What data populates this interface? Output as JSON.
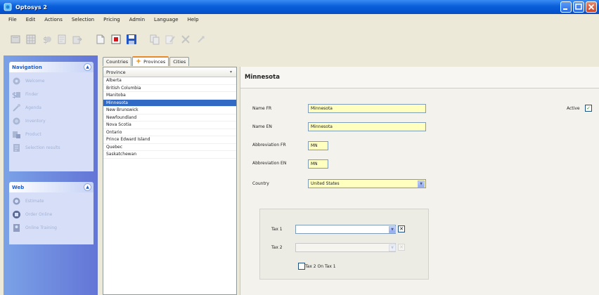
{
  "window": {
    "title": "Optosys 2"
  },
  "menu": [
    "File",
    "Edit",
    "Actions",
    "Selection",
    "Pricing",
    "Admin",
    "Language",
    "Help"
  ],
  "colors": {
    "accent": "#316ac5",
    "required_field": "#ffffc0",
    "title_bar": "#0a5fd8",
    "active_tab": "#e68b2c"
  },
  "sidebar": {
    "navigation": {
      "title": "Navigation",
      "items": [
        {
          "label": "Welcome",
          "icon": "welcome-icon"
        },
        {
          "label": "Finder",
          "icon": "finder-icon"
        },
        {
          "label": "Agenda",
          "icon": "agenda-icon"
        },
        {
          "label": "Inventory",
          "icon": "inventory-icon"
        },
        {
          "label": "Product",
          "icon": "product-icon"
        },
        {
          "label": "Selection results",
          "icon": "selection-icon"
        }
      ]
    },
    "web": {
      "title": "Web",
      "items": [
        {
          "label": "Estimate",
          "icon": "estimate-icon"
        },
        {
          "label": "Order Online",
          "icon": "order-icon"
        },
        {
          "label": "Online Training",
          "icon": "training-icon"
        }
      ]
    }
  },
  "tabs": [
    {
      "label": "Countries",
      "active": false
    },
    {
      "label": "Provinces",
      "active": true
    },
    {
      "label": "Cities",
      "active": false
    }
  ],
  "list": {
    "header": "Province",
    "items": [
      "Alberta",
      "British Columbia",
      "Manitoba",
      "Minnesota",
      "New Brunswick",
      "Newfoundland",
      "Nova Scotia",
      "Ontario",
      "Prince Edward Island",
      "Quebec",
      "Saskatchewan"
    ],
    "selected": "Minnesota"
  },
  "detail": {
    "title": "Minnesota",
    "active_label": "Active",
    "active_checked": true,
    "fields": {
      "name_fr": {
        "label": "Name FR",
        "value": "Minnesota"
      },
      "name_en": {
        "label": "Name EN",
        "value": "Minnesota"
      },
      "abbr_fr": {
        "label": "Abbreviation FR",
        "value": "MN"
      },
      "abbr_en": {
        "label": "Abbreviation EN",
        "value": "MN"
      },
      "country": {
        "label": "Country",
        "value": "United States"
      }
    },
    "tax": {
      "tax1_label": "Tax 1",
      "tax1_value": "",
      "tax2_label": "Tax 2",
      "tax2_value": "",
      "tax2_on_tax1_label": "Tax 2 On Tax 1",
      "tax2_on_tax1_checked": false
    }
  }
}
